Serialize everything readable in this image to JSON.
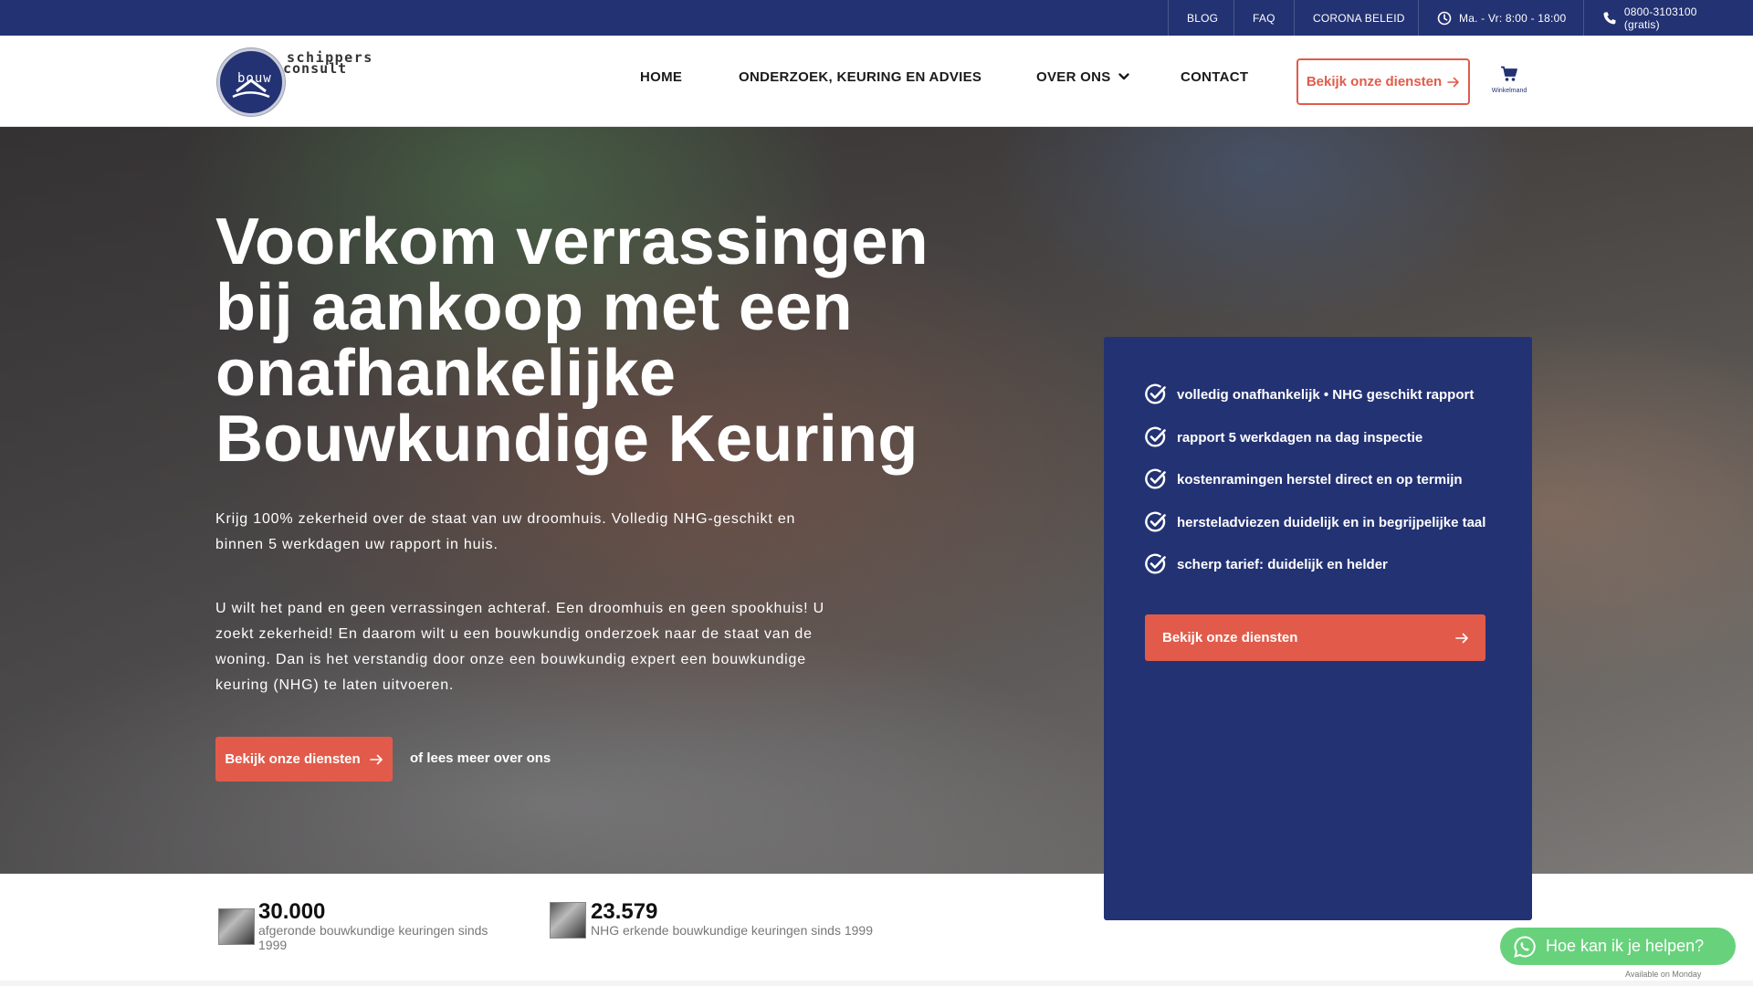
{
  "topbar": {
    "links": [
      "BLOG",
      "FAQ",
      "CORONA BELEID"
    ],
    "hours": "Ma. - Vr: 8:00 - 18:00",
    "phone": "0800-3103100 (gratis)"
  },
  "logo": {
    "word1": "schippers",
    "word2": "consult",
    "word3": "bouw"
  },
  "nav": {
    "home": "HOME",
    "onderzoek": "ONDERZOEK, KEURING EN ADVIES",
    "over_ons": "OVER ONS",
    "contact": "CONTACT",
    "cta": "Bekijk onze diensten",
    "cart_label": "Winkelmand"
  },
  "hero": {
    "title": "Voorkom verrassingen bij aankoop met een onafhankelijke Bouwkundige Keuring",
    "p1": "Krijg 100% zekerheid over de staat van uw droomhuis. Volledig NHG-geschikt en binnen 5 werkdagen uw rapport in huis.",
    "p2": "U wilt het pand en geen verrassingen achteraf. Een droomhuis en geen spookhuis! U zoekt zekerheid! En daarom wilt u een bouwkundig onderzoek naar de staat van de woning. Dan is het verstandig door onze een bouwkundig expert een bouwkundige keuring (NHG) te laten uitvoeren.",
    "cta": "Bekijk onze diensten",
    "secondary_link": "of lees meer over ons"
  },
  "panel": {
    "features": [
      "volledig onafhankelijk • NHG geschikt rapport",
      "rapport 5 werkdagen na dag inspectie",
      "kostenramingen herstel direct en op termijn",
      "hersteladviezen duidelijk en in begrijpelijke taal",
      "scherp tarief: duidelijk en helder"
    ],
    "cta": "Bekijk onze diensten"
  },
  "stats": [
    {
      "value": "30.000",
      "label_line1": "afgeronde bouwkundige keuringen sinds",
      "label_line2": "1999"
    },
    {
      "value": "23.579",
      "label_line1": "NHG erkende bouwkundige keuringen sinds 1999",
      "label_line2": ""
    }
  ],
  "whatsapp": {
    "label": "Hoe kan ik je helpen?",
    "availability": "Available on Monday"
  },
  "colors": {
    "navy": "#233273",
    "accent_red": "#e25b4a",
    "whatsapp_green": "#67d27b"
  }
}
